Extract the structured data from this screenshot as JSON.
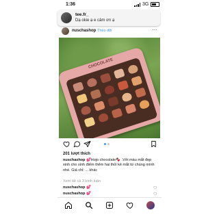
{
  "status_bar": {
    "time": "1:36",
    "network": "3G"
  },
  "notification": {
    "title": "tee.fr_",
    "message": "Dạ okie ạ e cảm ơn ạ"
  },
  "post": {
    "username": "nuschashop",
    "follow_label": "Theo dõi",
    "more_label": "···",
    "palette_label": "CHOCOLATE",
    "swatch_colors": [
      "#c98a7a",
      "#b8705e",
      "#9a4e3e",
      "#e3b59a",
      "#d7a27a",
      "#f0c67a",
      "#b06e52",
      "#8a3a2e",
      "#c9593e",
      "#e2a06a",
      "#a55a48",
      "#d98b6a",
      "#7a3a2a",
      "#e8b48a",
      "#c26c4e",
      "#f2d08a",
      "#9c4b36",
      "#b86248",
      "#d8866a",
      "#e6a05a"
    ],
    "likes": "201 lượt thích",
    "caption_user": "nuschashop",
    "caption_text": "💕Hojo chocolate🍫 .Với màu mắt đẹp xinh cho xinh điểm thêm hai thỏi kẻ mắt từ chúng mình nhé. Giá chỉ: ... khác",
    "caption_more": "",
    "view_all_comments": "Xem tất cả 3 bình luận",
    "comments": [
      {
        "user": "nuschashop",
        "text": "💕"
      },
      {
        "user": "nuschashop",
        "text": "💕"
      }
    ]
  }
}
